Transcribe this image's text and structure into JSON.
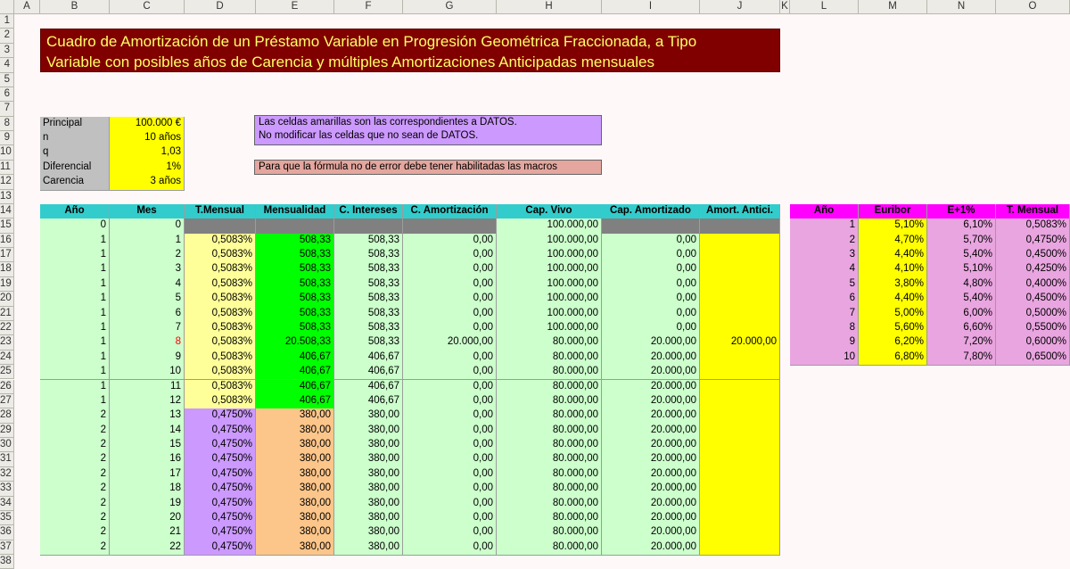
{
  "columns": [
    "A",
    "B",
    "C",
    "D",
    "E",
    "F",
    "G",
    "H",
    "I",
    "J",
    "K",
    "L",
    "M",
    "N",
    "O"
  ],
  "title": {
    "line1": "Cuadro de Amortización de un Préstamo Variable en Progresión Geométrica Fraccionada, a Tipo",
    "line2": "Variable con posibles años de Carencia y múltiples Amortizaciones Anticipadas mensuales"
  },
  "inputs": [
    {
      "label": "Principal",
      "value": "100.000 €"
    },
    {
      "label": "n",
      "value": "10 años"
    },
    {
      "label": "q",
      "value": "1,03"
    },
    {
      "label": "Diferencial",
      "value": "1%"
    },
    {
      "label": "Carencia",
      "value": "3 años"
    }
  ],
  "notes": {
    "info_line1": "Las celdas amarillas son las correspondientes a DATOS.",
    "info_line2": "No modificar las celdas que no sean de DATOS.",
    "warning": "Para que la fórmula no de error debe tener habilitadas las macros"
  },
  "table": {
    "headers": [
      "Año",
      "Mes",
      "T.Mensual",
      "Mensualidad",
      "C. Intereses",
      "C. Amortización",
      "Cap. Vivo",
      "Cap. Amortizado",
      "Amort. Antici."
    ],
    "rows": [
      [
        "0",
        "0",
        "",
        "",
        "",
        "",
        "100.000,00",
        "",
        ""
      ],
      [
        "1",
        "1",
        "0,5083%",
        "508,33",
        "508,33",
        "0,00",
        "100.000,00",
        "0,00",
        ""
      ],
      [
        "1",
        "2",
        "0,5083%",
        "508,33",
        "508,33",
        "0,00",
        "100.000,00",
        "0,00",
        ""
      ],
      [
        "1",
        "3",
        "0,5083%",
        "508,33",
        "508,33",
        "0,00",
        "100.000,00",
        "0,00",
        ""
      ],
      [
        "1",
        "4",
        "0,5083%",
        "508,33",
        "508,33",
        "0,00",
        "100.000,00",
        "0,00",
        ""
      ],
      [
        "1",
        "5",
        "0,5083%",
        "508,33",
        "508,33",
        "0,00",
        "100.000,00",
        "0,00",
        ""
      ],
      [
        "1",
        "6",
        "0,5083%",
        "508,33",
        "508,33",
        "0,00",
        "100.000,00",
        "0,00",
        ""
      ],
      [
        "1",
        "7",
        "0,5083%",
        "508,33",
        "508,33",
        "0,00",
        "100.000,00",
        "0,00",
        ""
      ],
      [
        "1",
        "8",
        "0,5083%",
        "20.508,33",
        "508,33",
        "20.000,00",
        "80.000,00",
        "20.000,00",
        "20.000,00"
      ],
      [
        "1",
        "9",
        "0,5083%",
        "406,67",
        "406,67",
        "0,00",
        "80.000,00",
        "20.000,00",
        ""
      ],
      [
        "1",
        "10",
        "0,5083%",
        "406,67",
        "406,67",
        "0,00",
        "80.000,00",
        "20.000,00",
        ""
      ],
      [
        "1",
        "11",
        "0,5083%",
        "406,67",
        "406,67",
        "0,00",
        "80.000,00",
        "20.000,00",
        ""
      ],
      [
        "1",
        "12",
        "0,5083%",
        "406,67",
        "406,67",
        "0,00",
        "80.000,00",
        "20.000,00",
        ""
      ],
      [
        "2",
        "13",
        "0,4750%",
        "380,00",
        "380,00",
        "0,00",
        "80.000,00",
        "20.000,00",
        ""
      ],
      [
        "2",
        "14",
        "0,4750%",
        "380,00",
        "380,00",
        "0,00",
        "80.000,00",
        "20.000,00",
        ""
      ],
      [
        "2",
        "15",
        "0,4750%",
        "380,00",
        "380,00",
        "0,00",
        "80.000,00",
        "20.000,00",
        ""
      ],
      [
        "2",
        "16",
        "0,4750%",
        "380,00",
        "380,00",
        "0,00",
        "80.000,00",
        "20.000,00",
        ""
      ],
      [
        "2",
        "17",
        "0,4750%",
        "380,00",
        "380,00",
        "0,00",
        "80.000,00",
        "20.000,00",
        ""
      ],
      [
        "2",
        "18",
        "0,4750%",
        "380,00",
        "380,00",
        "0,00",
        "80.000,00",
        "20.000,00",
        ""
      ],
      [
        "2",
        "19",
        "0,4750%",
        "380,00",
        "380,00",
        "0,00",
        "80.000,00",
        "20.000,00",
        ""
      ],
      [
        "2",
        "20",
        "0,4750%",
        "380,00",
        "380,00",
        "0,00",
        "80.000,00",
        "20.000,00",
        ""
      ],
      [
        "2",
        "21",
        "0,4750%",
        "380,00",
        "380,00",
        "0,00",
        "80.000,00",
        "20.000,00",
        ""
      ],
      [
        "2",
        "22",
        "0,4750%",
        "380,00",
        "380,00",
        "0,00",
        "80.000,00",
        "20.000,00",
        ""
      ]
    ]
  },
  "rates": {
    "headers": [
      "Año",
      "Euribor",
      "E+1%",
      "T. Mensual"
    ],
    "rows": [
      [
        "1",
        "5,10%",
        "6,10%",
        "0,5083%"
      ],
      [
        "2",
        "4,70%",
        "5,70%",
        "0,4750%"
      ],
      [
        "3",
        "4,40%",
        "5,40%",
        "0,4500%"
      ],
      [
        "4",
        "4,10%",
        "5,10%",
        "0,4250%"
      ],
      [
        "5",
        "3,80%",
        "4,80%",
        "0,4000%"
      ],
      [
        "6",
        "4,40%",
        "5,40%",
        "0,4500%"
      ],
      [
        "7",
        "5,00%",
        "6,00%",
        "0,5000%"
      ],
      [
        "8",
        "5,60%",
        "6,60%",
        "0,5500%"
      ],
      [
        "9",
        "6,20%",
        "7,20%",
        "0,6000%"
      ],
      [
        "10",
        "6,80%",
        "7,80%",
        "0,6500%"
      ]
    ]
  },
  "colors": {
    "title_bg": "#800000",
    "title_text": "#ffff66",
    "input_label": "#c0c0c0",
    "input_value": "#ffff00",
    "header_bg": "#33cccc",
    "row_bg": "#ccffcc",
    "dark_cell": "#808080",
    "mensualidad_green": "#00ff00",
    "mensualidad_orange": "#fcc58a",
    "rate_yellow": "#ffff99",
    "rate_violet": "#cc99ff",
    "amort_yellow": "#ffff00",
    "pink": "#e9a5e0",
    "rates_header": "#ff00ff",
    "info_bg": "#cc99ff",
    "warning_bg": "#e4a69e"
  }
}
